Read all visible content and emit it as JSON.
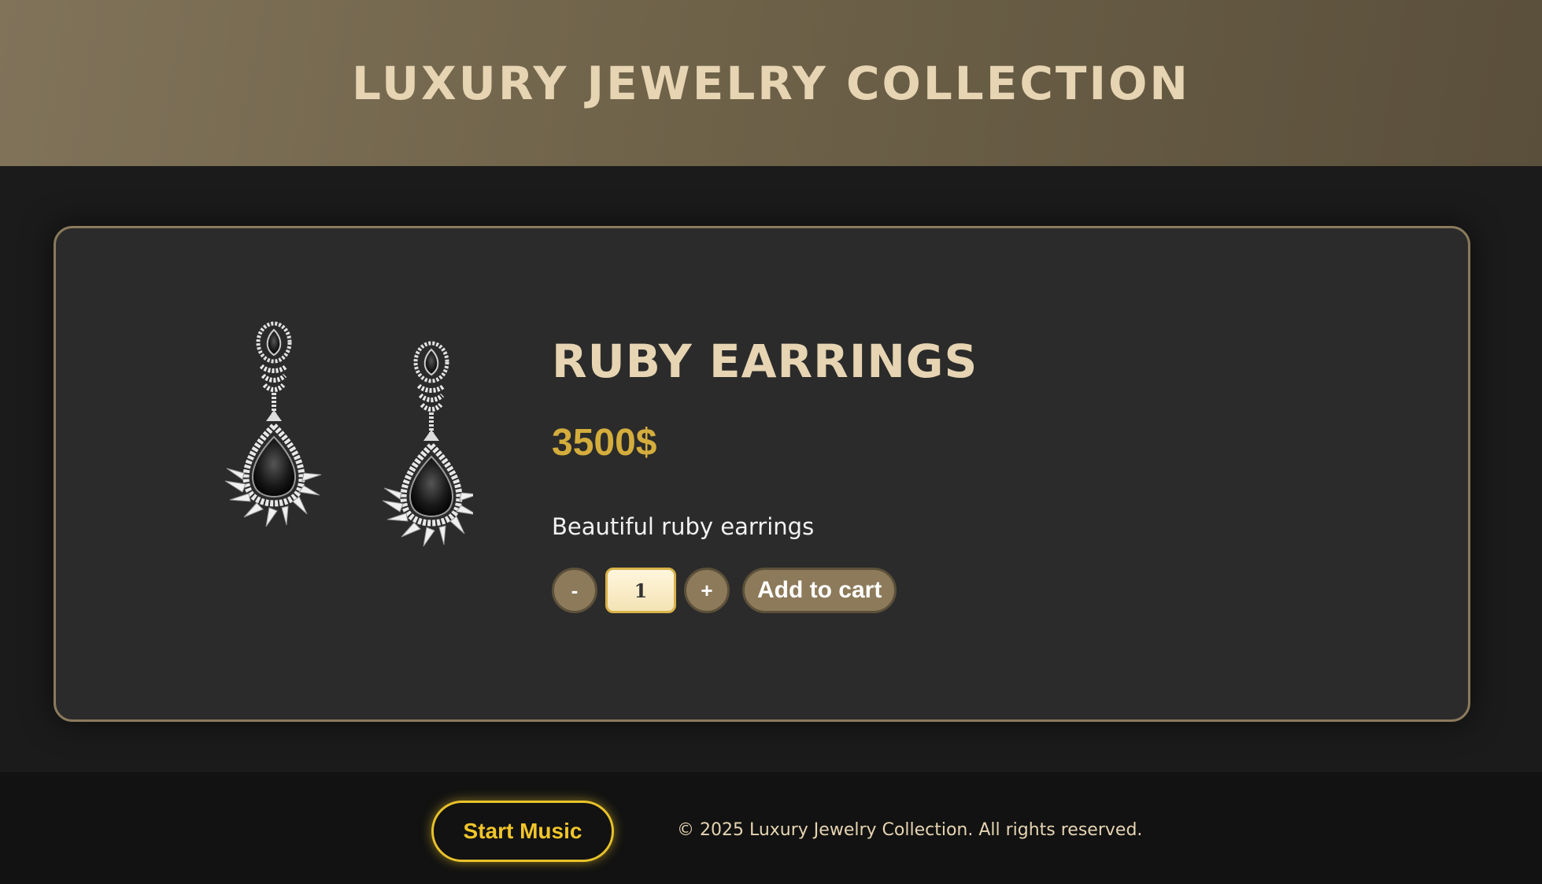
{
  "header": {
    "title": "LUXURY JEWELRY COLLECTION"
  },
  "product": {
    "name": "RUBY EARRINGS",
    "price": "3500$",
    "description": "Beautiful ruby earrings",
    "image_icon": "earrings-image"
  },
  "controls": {
    "decrement_label": "-",
    "quantity": "1",
    "increment_label": "+",
    "add_to_cart_label": "Add to cart"
  },
  "footer": {
    "music_button": "Start Music",
    "copyright": "© 2025 Luxury Jewelry Collection. All rights reserved."
  },
  "colors": {
    "accent_gold": "#d4ad3c",
    "title_cream": "#e6d4b2",
    "button_brown": "#8c7a5a",
    "music_yellow": "#f1c52a"
  }
}
